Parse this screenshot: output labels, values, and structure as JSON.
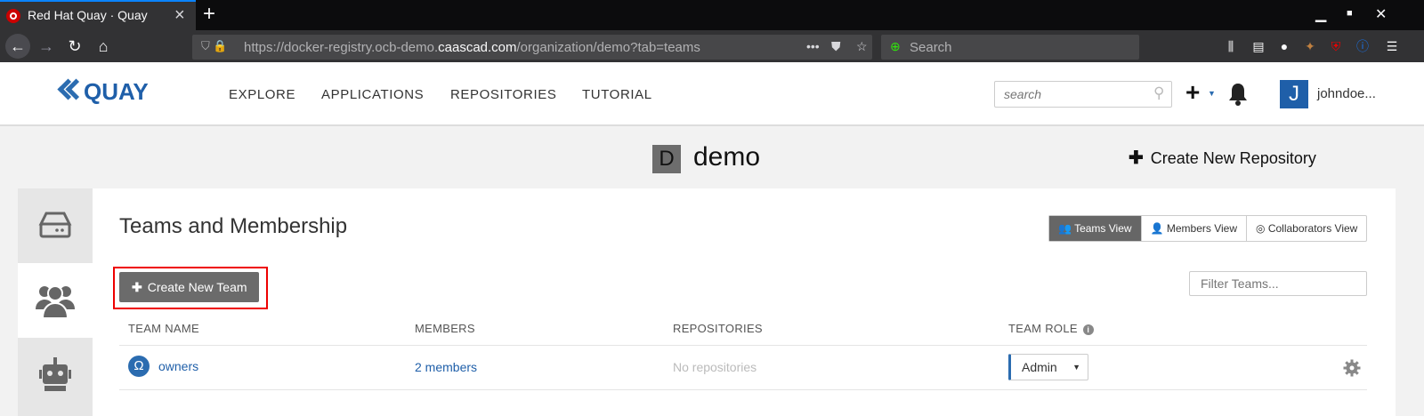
{
  "browser": {
    "tab_title": "Red Hat Quay · Quay",
    "tab_close": "×",
    "new_tab": "+",
    "url_prefix": "https://docker-registry.ocb-demo.",
    "url_domain": "caascad.com",
    "url_path": "/organization/demo?tab=teams",
    "search_placeholder": "Search"
  },
  "quay": {
    "logo_text": "QUAY",
    "nav": [
      "EXPLORE",
      "APPLICATIONS",
      "REPOSITORIES",
      "TUTORIAL"
    ],
    "search_placeholder": "search",
    "avatar_letter": "J",
    "username": "johndoe..."
  },
  "org": {
    "avatar_letter": "D",
    "name": "demo",
    "create_repo_label": "Create New Repository"
  },
  "teams": {
    "title": "Teams and Membership",
    "views": [
      "Teams View",
      "Members View",
      "Collaborators View"
    ],
    "create_team_label": "Create New Team",
    "filter_placeholder": "Filter Teams...",
    "columns": [
      "TEAM NAME",
      "MEMBERS",
      "REPOSITORIES",
      "TEAM ROLE"
    ],
    "rows": [
      {
        "name": "owners",
        "members": "2 members",
        "repositories": "No repositories",
        "role": "Admin"
      }
    ]
  },
  "colors": {
    "accent": "#1f5fa9",
    "highlight": "#ee0000",
    "tab_active": "#0a84ff"
  }
}
